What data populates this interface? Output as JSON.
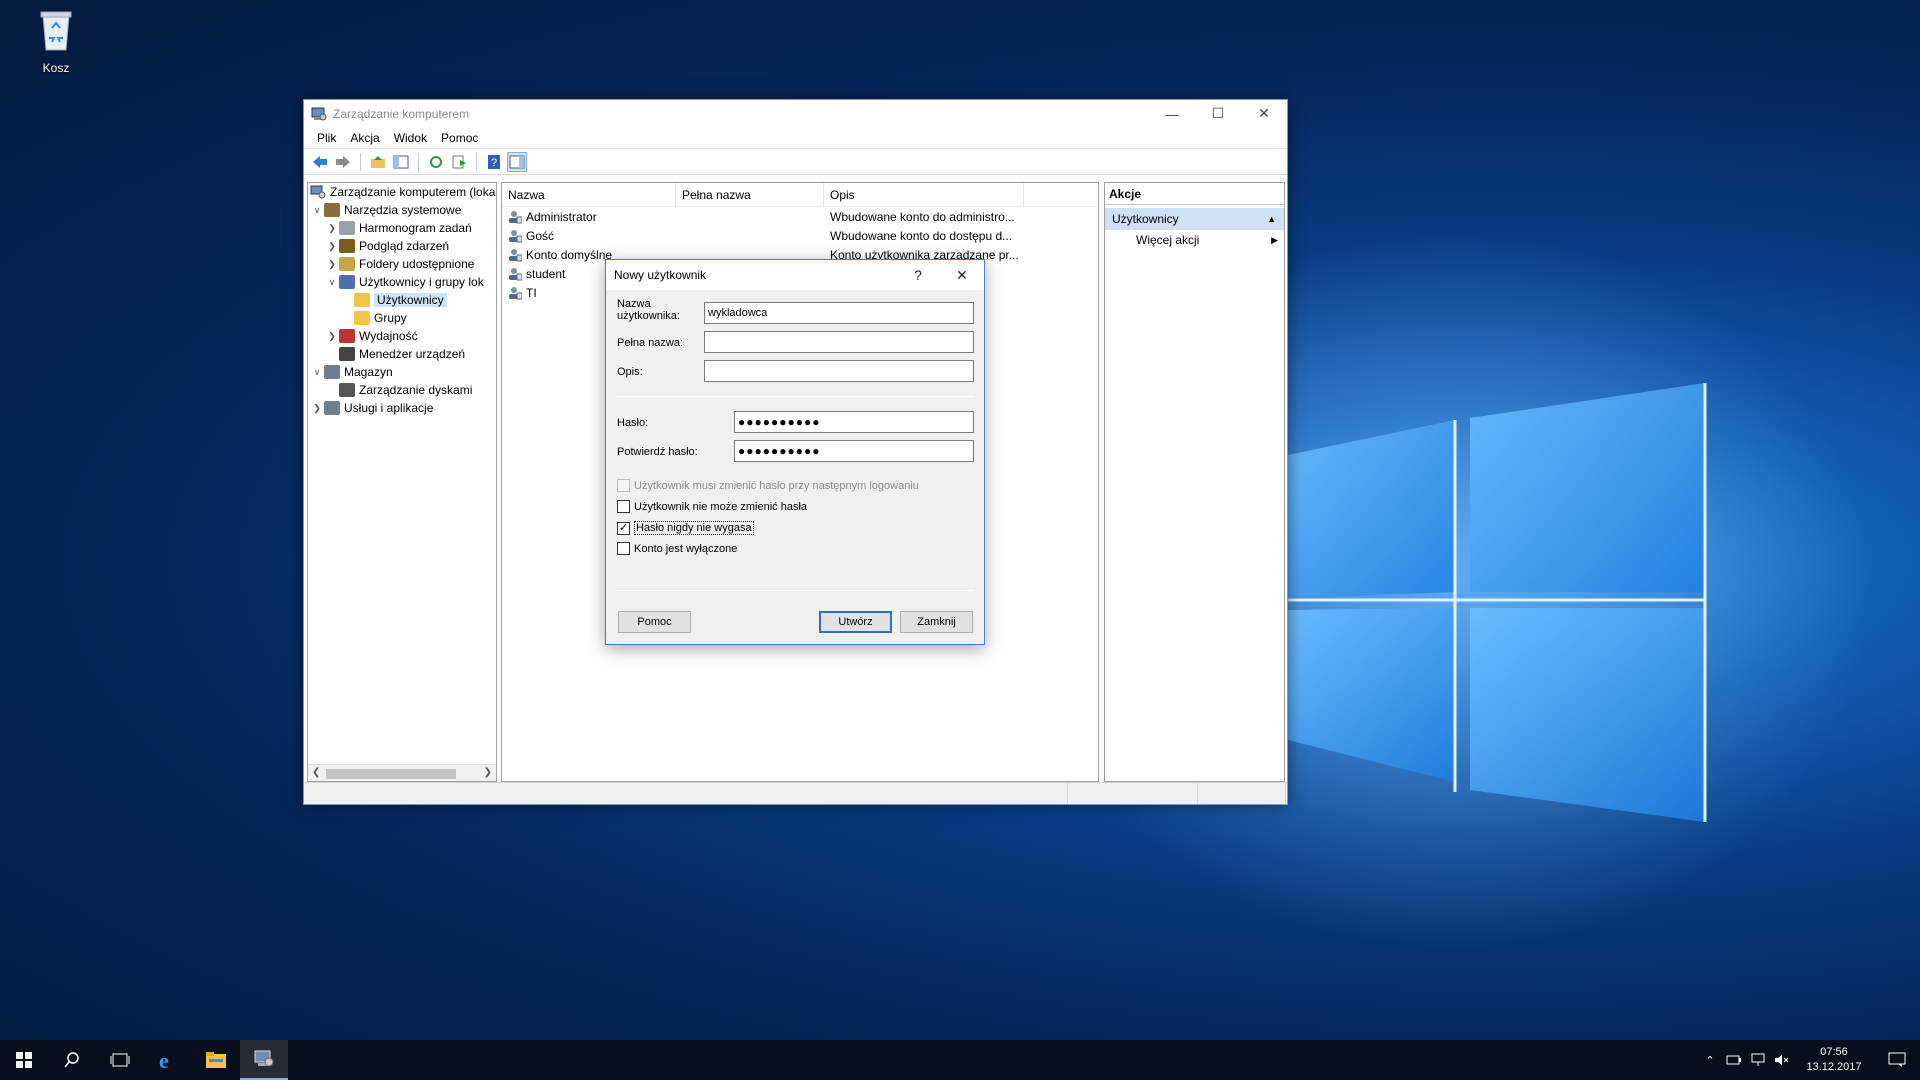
{
  "desktop": {
    "recycle_bin_label": "Kosz"
  },
  "window": {
    "title": "Zarządzanie komputerem",
    "menu": [
      "Plik",
      "Akcja",
      "Widok",
      "Pomoc"
    ],
    "tree": {
      "root": "Zarządzanie komputerem (loka",
      "items": [
        {
          "label": "Narzędzia systemowe",
          "level": 1,
          "expander": "open"
        },
        {
          "label": "Harmonogram zadań",
          "level": 2,
          "expander": "closed"
        },
        {
          "label": "Podgląd zdarzeń",
          "level": 2,
          "expander": "closed"
        },
        {
          "label": "Foldery udostępnione",
          "level": 2,
          "expander": "closed"
        },
        {
          "label": "Użytkownicy i grupy lok",
          "level": 2,
          "expander": "open"
        },
        {
          "label": "Użytkownicy",
          "level": 3,
          "expander": "none",
          "selected": true
        },
        {
          "label": "Grupy",
          "level": 3,
          "expander": "none"
        },
        {
          "label": "Wydajność",
          "level": 2,
          "expander": "closed"
        },
        {
          "label": "Menedżer urządzeń",
          "level": 2,
          "expander": "none"
        },
        {
          "label": "Magazyn",
          "level": 1,
          "expander": "open"
        },
        {
          "label": "Zarządzanie dyskami",
          "level": 2,
          "expander": "none"
        },
        {
          "label": "Usługi i aplikacje",
          "level": 1,
          "expander": "closed"
        }
      ]
    },
    "list": {
      "columns": [
        "Nazwa",
        "Pełna nazwa",
        "Opis"
      ],
      "rows": [
        {
          "name": "Administrator",
          "full": "",
          "desc": "Wbudowane konto do administro..."
        },
        {
          "name": "Gość",
          "full": "",
          "desc": "Wbudowane konto do dostępu d..."
        },
        {
          "name": "Konto domyślne",
          "full": "",
          "desc": "Konto użytkownika zarządzane pr..."
        },
        {
          "name": "student",
          "full": "",
          "desc": ""
        },
        {
          "name": "TI",
          "full": "",
          "desc": ""
        }
      ]
    },
    "actions": {
      "header": "Akcje",
      "section": "Użytkownicy",
      "more": "Więcej akcji"
    }
  },
  "dialog": {
    "title": "Nowy użytkownik",
    "help_glyph": "?",
    "username_label": "Nazwa użytkownika:",
    "username_value": "wykladowca",
    "fullname_label": "Pełna nazwa:",
    "fullname_value": "",
    "desc_label": "Opis:",
    "desc_value": "",
    "password_label": "Hasło:",
    "password_value": "●●●●●●●●●●",
    "confirm_label": "Potwierdź hasło:",
    "confirm_value": "●●●●●●●●●●",
    "checkboxes": [
      {
        "label": "Użytkownik musi zmienić hasło przy następnym logowaniu",
        "checked": false,
        "disabled": true
      },
      {
        "label": "Użytkownik nie może zmienić hasła",
        "checked": false,
        "disabled": false
      },
      {
        "label": "Hasło nigdy nie wygasa",
        "checked": true,
        "disabled": false
      },
      {
        "label": "Konto jest wyłączone",
        "checked": false,
        "disabled": false
      }
    ],
    "btn_help": "Pomoc",
    "btn_create": "Utwórz",
    "btn_close": "Zamknij"
  },
  "taskbar": {
    "time": "07:56",
    "date": "13.12.2017"
  }
}
